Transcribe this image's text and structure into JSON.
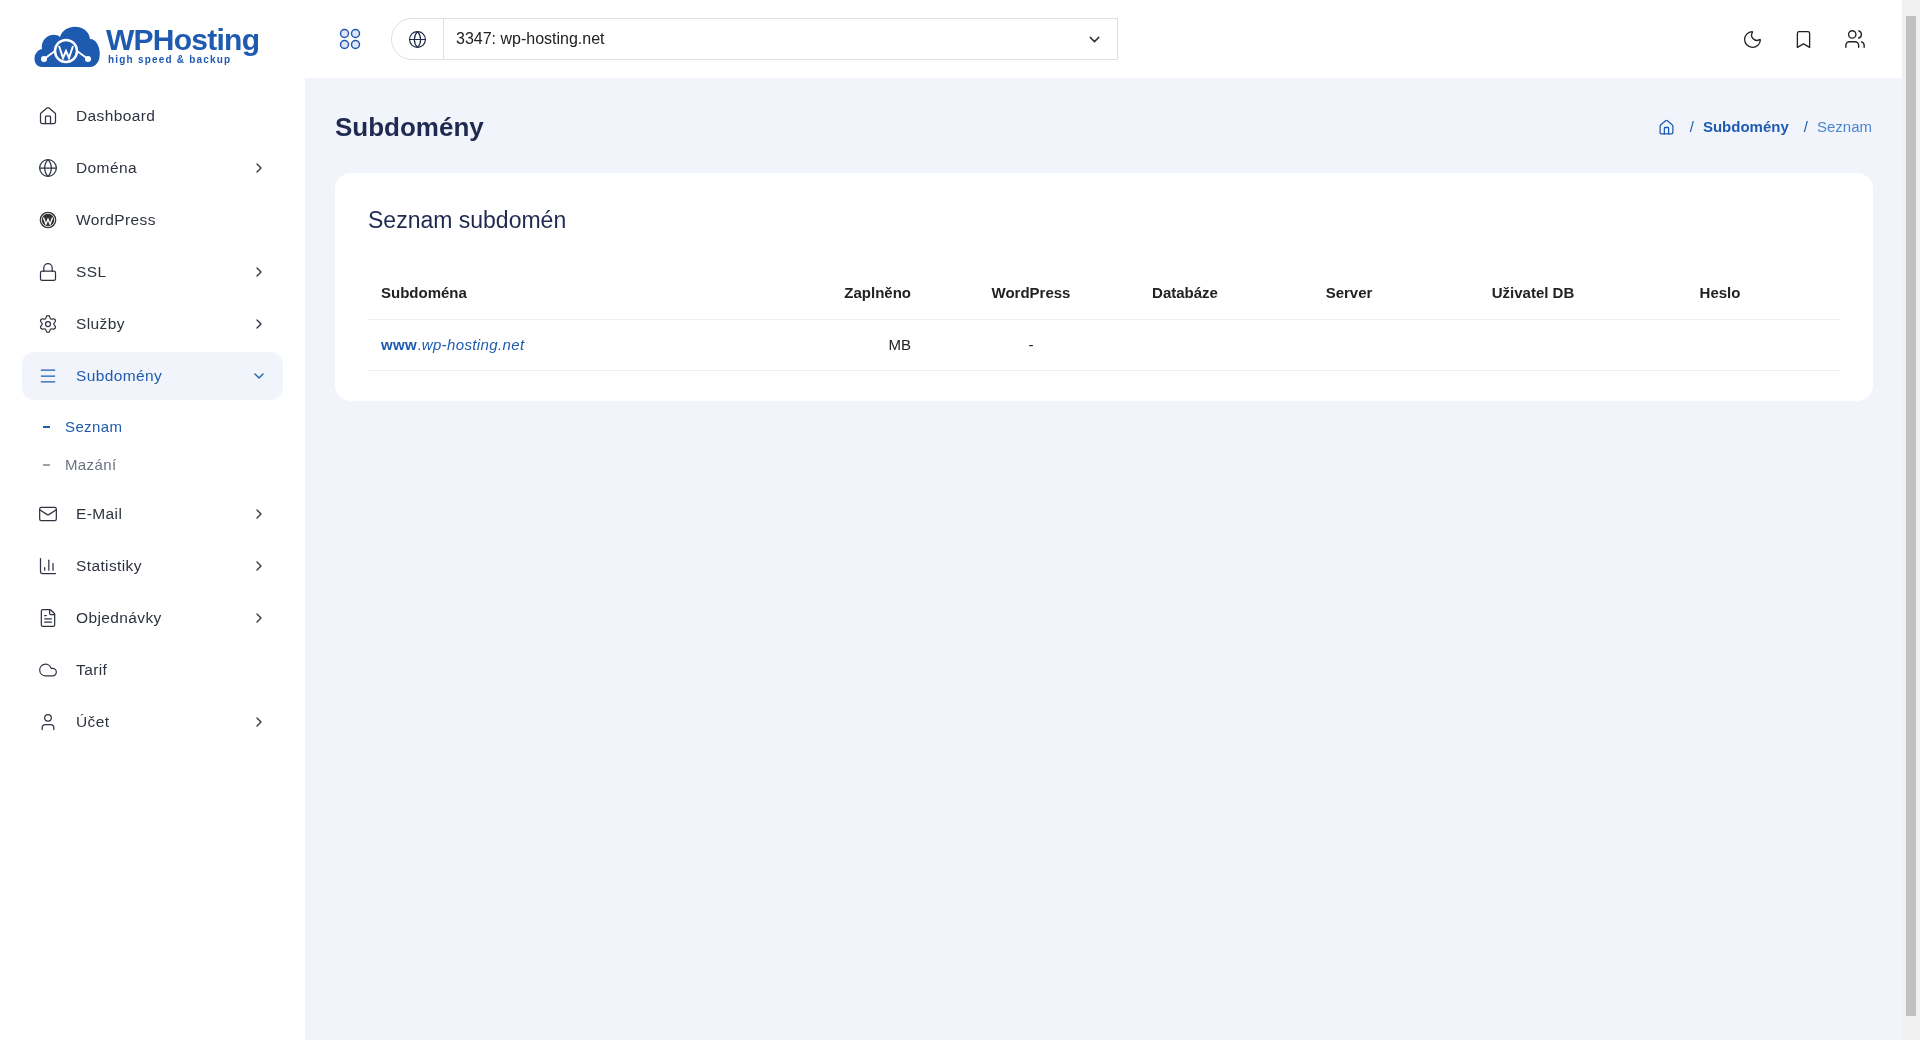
{
  "logo": {
    "name": "WPHosting",
    "tagline": "high speed & backup"
  },
  "sidebar": {
    "items": [
      {
        "label": "Dashboard",
        "has_submenu": false,
        "selected": false
      },
      {
        "label": "Doména",
        "has_submenu": true,
        "expanded": false,
        "selected": false
      },
      {
        "label": "WordPress",
        "has_submenu": false,
        "selected": false
      },
      {
        "label": "SSL",
        "has_submenu": true,
        "expanded": false,
        "selected": false
      },
      {
        "label": "Služby",
        "has_submenu": true,
        "expanded": false,
        "selected": false
      },
      {
        "label": "Subdomény",
        "has_submenu": true,
        "expanded": true,
        "selected": true,
        "children": [
          {
            "label": "Seznam",
            "selected": true
          },
          {
            "label": "Mazání",
            "selected": false
          }
        ]
      },
      {
        "label": "E-Mail",
        "has_submenu": true,
        "expanded": false,
        "selected": false
      },
      {
        "label": "Statistiky",
        "has_submenu": true,
        "expanded": false,
        "selected": false
      },
      {
        "label": "Objednávky",
        "has_submenu": true,
        "expanded": false,
        "selected": false
      },
      {
        "label": "Tarif",
        "has_submenu": false,
        "selected": false
      },
      {
        "label": "Účet",
        "has_submenu": true,
        "expanded": false,
        "selected": false
      }
    ]
  },
  "topbar": {
    "domain_select": {
      "value": "3347: wp-hosting.net"
    }
  },
  "page": {
    "title": "Subdomény",
    "breadcrumb": [
      {
        "kind": "separator",
        "text": "/"
      },
      {
        "kind": "link",
        "text": "Subdomény"
      },
      {
        "kind": "separator",
        "text": "/"
      },
      {
        "kind": "current",
        "text": "Seznam"
      }
    ]
  },
  "card": {
    "title": "Seznam subdomén",
    "table": {
      "columns": [
        {
          "label": "Subdoména"
        },
        {
          "label": "Zaplněno"
        },
        {
          "label": "WordPress"
        },
        {
          "label": "Databáze"
        },
        {
          "label": "Server"
        },
        {
          "label": "Uživatel DB"
        },
        {
          "label": "Heslo"
        }
      ],
      "rows": [
        {
          "cells": [
            {
              "kind": "link",
              "text": "**www**.*wp-hosting.net*"
            },
            {
              "kind": "text",
              "text": "MB"
            },
            {
              "kind": "text",
              "text": "-"
            }
          ]
        }
      ]
    }
  }
}
